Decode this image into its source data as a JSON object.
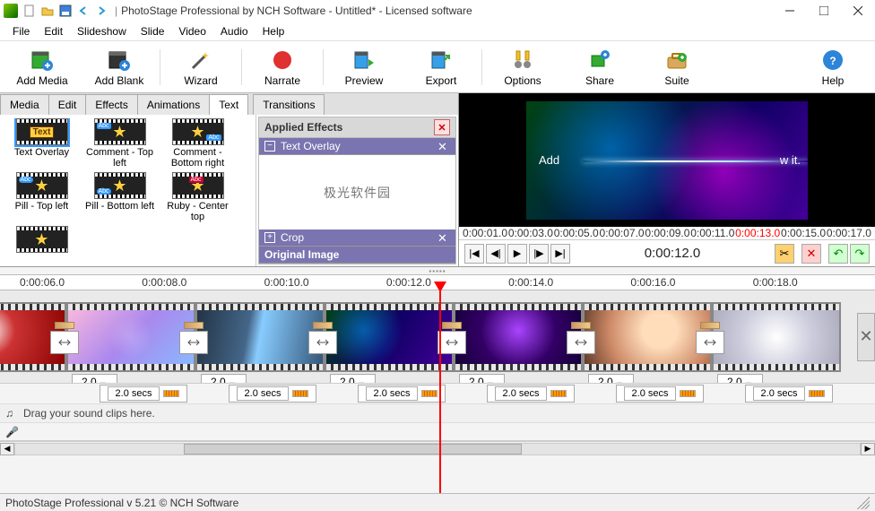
{
  "title": "PhotoStage Professional by NCH Software - Untitled* - Licensed software",
  "menu": [
    "File",
    "Edit",
    "Slideshow",
    "Slide",
    "Video",
    "Audio",
    "Help"
  ],
  "toolbar": [
    {
      "label": "Add Media",
      "key": "add-media"
    },
    {
      "label": "Add Blank",
      "key": "add-blank"
    },
    {
      "label": "Wizard",
      "key": "wizard"
    },
    {
      "label": "Narrate",
      "key": "narrate"
    },
    {
      "label": "Preview",
      "key": "preview"
    },
    {
      "label": "Export",
      "key": "export"
    },
    {
      "label": "Options",
      "key": "options"
    },
    {
      "label": "Share",
      "key": "share"
    },
    {
      "label": "Suite",
      "key": "suite"
    }
  ],
  "toolbar_help": "Help",
  "panel_tabs_a": [
    "Media",
    "Edit",
    "Effects",
    "Animations",
    "Text"
  ],
  "panel_tabs_b": [
    "Transitions"
  ],
  "panel_active": "Text",
  "text_effects": [
    "Text Overlay",
    "Comment - Top left",
    "Comment - Bottom right",
    "Pill - Top left",
    "Pill - Bottom left",
    "Ruby - Center top"
  ],
  "applied_header": "Applied Effects",
  "applied": [
    {
      "name": "Text Overlay",
      "expanded": true,
      "body": "极光软件园"
    },
    {
      "name": "Crop",
      "expanded": false
    }
  ],
  "original_image": "Original Image",
  "preview_text_left": "Add",
  "preview_text_right": "w it.",
  "preview_ruler": [
    "0:00:01.0",
    "0:00:03.0",
    "0:00:05.0",
    "0:00:07.0",
    "0:00:09.0",
    "0:00:11.0",
    "0:00:13.0",
    "0:00:15.0",
    "0:00:17.0"
  ],
  "preview_ruler_mark_index": 6,
  "timecode": "0:00:12.0",
  "timeline_ruler": [
    "0:00:06.0",
    "0:00:08.0",
    "0:00:10.0",
    "0:00:12.0",
    "0:00:14.0",
    "0:00:16.0",
    "0:00:18.0"
  ],
  "clip_duration": "2.0",
  "transition_duration": "2.0 secs",
  "audio_hint": "Drag your sound clips here.",
  "status": "PhotoStage Professional v 5.21 © NCH Software"
}
